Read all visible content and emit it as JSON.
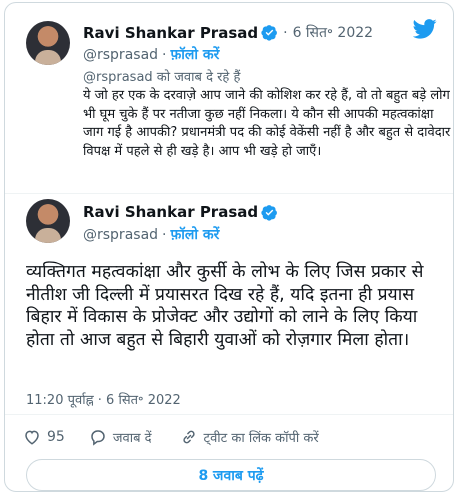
{
  "quoted_tweet": {
    "author_name": "Ravi Shankar Prasad",
    "separator": "·",
    "date": "6 सित॰ 2022",
    "handle": "@rsprasad",
    "dot": "·",
    "follow_label": "फ़ॉलो करें",
    "reply_to": "@rsprasad को जवाब दे रहे हैं",
    "text": "ये जो हर एक के दरवाज़े आप जाने की कोशिश कर रहे हैं, वो तो बहुत बड़े लोग भी घूम चुके हैं पर नतीजा कुछ नहीं निकला। ये कौन सी आपकी महत्वकांक्षा जाग गई है आपकी? प्रधानमंत्री पद की कोई वेकेंसी नहीं है और बहुत से दावेदार विपक्ष में पहले से ही खड़े है। आप भी खड़े हो जाएँ।"
  },
  "main_tweet": {
    "author_name": "Ravi Shankar Prasad",
    "handle": "@rsprasad",
    "dot": "·",
    "follow_label": "फ़ॉलो करें",
    "text": "व्यक्तिगत महत्वकांक्षा और कुर्सी के लोभ के लिए जिस प्रकार से नीतीश जी दिल्ली में प्रयासरत दिख रहे हैं, यदि इतना ही प्रयास बिहार में विकास के प्रोजेक्ट और उद्योगों को लाने के लिए किया होता तो आज बहुत से बिहारी युवाओं को रोज़गार मिला होता।",
    "timestamp": "11:20 पूर्वाह्न · 6 सित॰ 2022"
  },
  "actions": {
    "like_count": "95",
    "reply_label": "जवाब दें",
    "copy_link_label": "ट्वीट का लिंक कॉपी करें"
  },
  "read_replies_label": "8 जवाब पढ़ें",
  "colors": {
    "accent": "#1d9bf0",
    "like": "#f91880",
    "muted": "#536471"
  },
  "icons": [
    "twitter-logo-icon",
    "verified-badge-icon",
    "heart-icon",
    "reply-icon",
    "link-icon"
  ]
}
